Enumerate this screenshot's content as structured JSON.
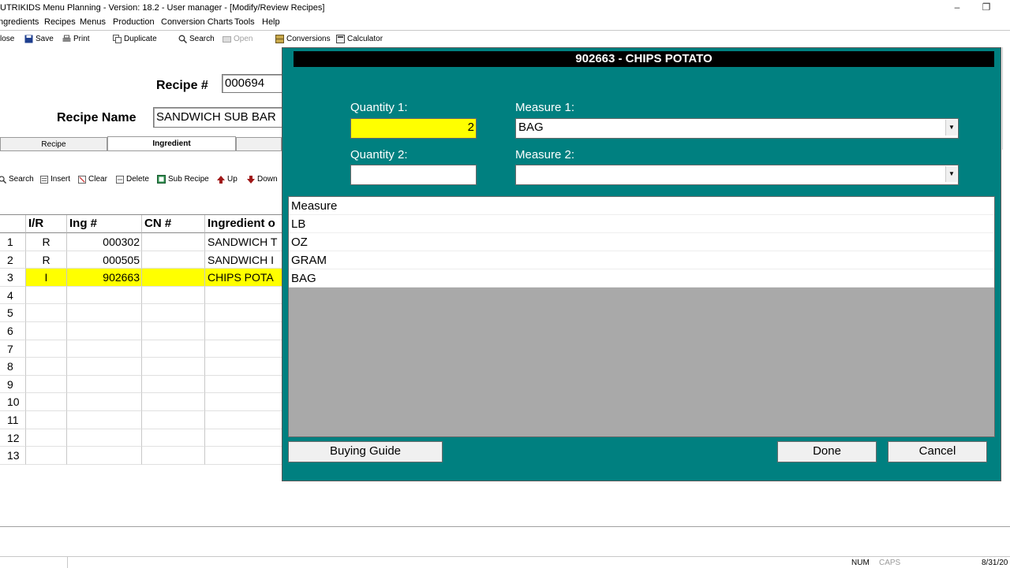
{
  "window": {
    "title": "UTRIKIDS Menu Planning - Version: 18.2 - User manager - [Modify/Review Recipes]",
    "minimize": "–",
    "restore": "❐"
  },
  "menu": [
    "ngredients",
    "Recipes",
    "Menus",
    "Production",
    "Conversion Charts",
    "Tools",
    "Help"
  ],
  "toolbar": {
    "close": "lose",
    "save": "Save",
    "print": "Print",
    "duplicate": "Duplicate",
    "search": "Search",
    "open": "Open",
    "conversions": "Conversions",
    "calculator": "Calculator"
  },
  "recipe": {
    "number_label": "Recipe #",
    "number_value": "000694",
    "name_label": "Recipe Name",
    "name_value": "SANDWICH SUB BAR",
    "tabs": [
      "Recipe",
      "Ingredient"
    ]
  },
  "ingredient_toolbar": {
    "search": "Search",
    "insert": "Insert",
    "clear": "Clear",
    "delete": "Delete",
    "sub_recipe": "Sub Recipe",
    "up": "Up",
    "down": "Down"
  },
  "grid": {
    "headers": [
      "",
      "I/R",
      "Ing #",
      "CN #",
      "Ingredient o"
    ],
    "rows": [
      {
        "n": "1",
        "ir": "R",
        "ing": "000302",
        "cn": "",
        "name": "SANDWICH T"
      },
      {
        "n": "2",
        "ir": "R",
        "ing": "000505",
        "cn": "",
        "name": "SANDWICH I"
      },
      {
        "n": "3",
        "ir": "I",
        "ing": "902663",
        "cn": "",
        "name": "CHIPS POTA"
      },
      {
        "n": "4",
        "ir": "",
        "ing": "",
        "cn": "",
        "name": ""
      },
      {
        "n": "5",
        "ir": "",
        "ing": "",
        "cn": "",
        "name": ""
      },
      {
        "n": "6",
        "ir": "",
        "ing": "",
        "cn": "",
        "name": ""
      },
      {
        "n": "7",
        "ir": "",
        "ing": "",
        "cn": "",
        "name": ""
      },
      {
        "n": "8",
        "ir": "",
        "ing": "",
        "cn": "",
        "name": ""
      },
      {
        "n": "9",
        "ir": "",
        "ing": "",
        "cn": "",
        "name": ""
      },
      {
        "n": "10",
        "ir": "",
        "ing": "",
        "cn": "",
        "name": ""
      },
      {
        "n": "11",
        "ir": "",
        "ing": "",
        "cn": "",
        "name": ""
      },
      {
        "n": "12",
        "ir": "",
        "ing": "",
        "cn": "",
        "name": ""
      },
      {
        "n": "13",
        "ir": "",
        "ing": "",
        "cn": "",
        "name": ""
      }
    ],
    "selected_row": 3
  },
  "dialog": {
    "title": "902663 - CHIPS POTATO",
    "quantity1_label": "Quantity 1:",
    "quantity1_value": "2",
    "measure1_label": "Measure 1:",
    "measure1_value": "BAG",
    "quantity2_label": "Quantity 2:",
    "quantity2_value": "",
    "measure2_label": "Measure 2:",
    "measure2_value": "",
    "list_header": "Measure",
    "measures": [
      "LB",
      "OZ",
      "GRAM",
      "BAG"
    ],
    "buying_guide": "Buying Guide",
    "done": "Done",
    "cancel": "Cancel"
  },
  "status": {
    "num": "NUM",
    "caps": "CAPS",
    "date": "8/31/20"
  },
  "colors": {
    "dialog_bg": "#008080",
    "highlight": "#ffff00"
  }
}
